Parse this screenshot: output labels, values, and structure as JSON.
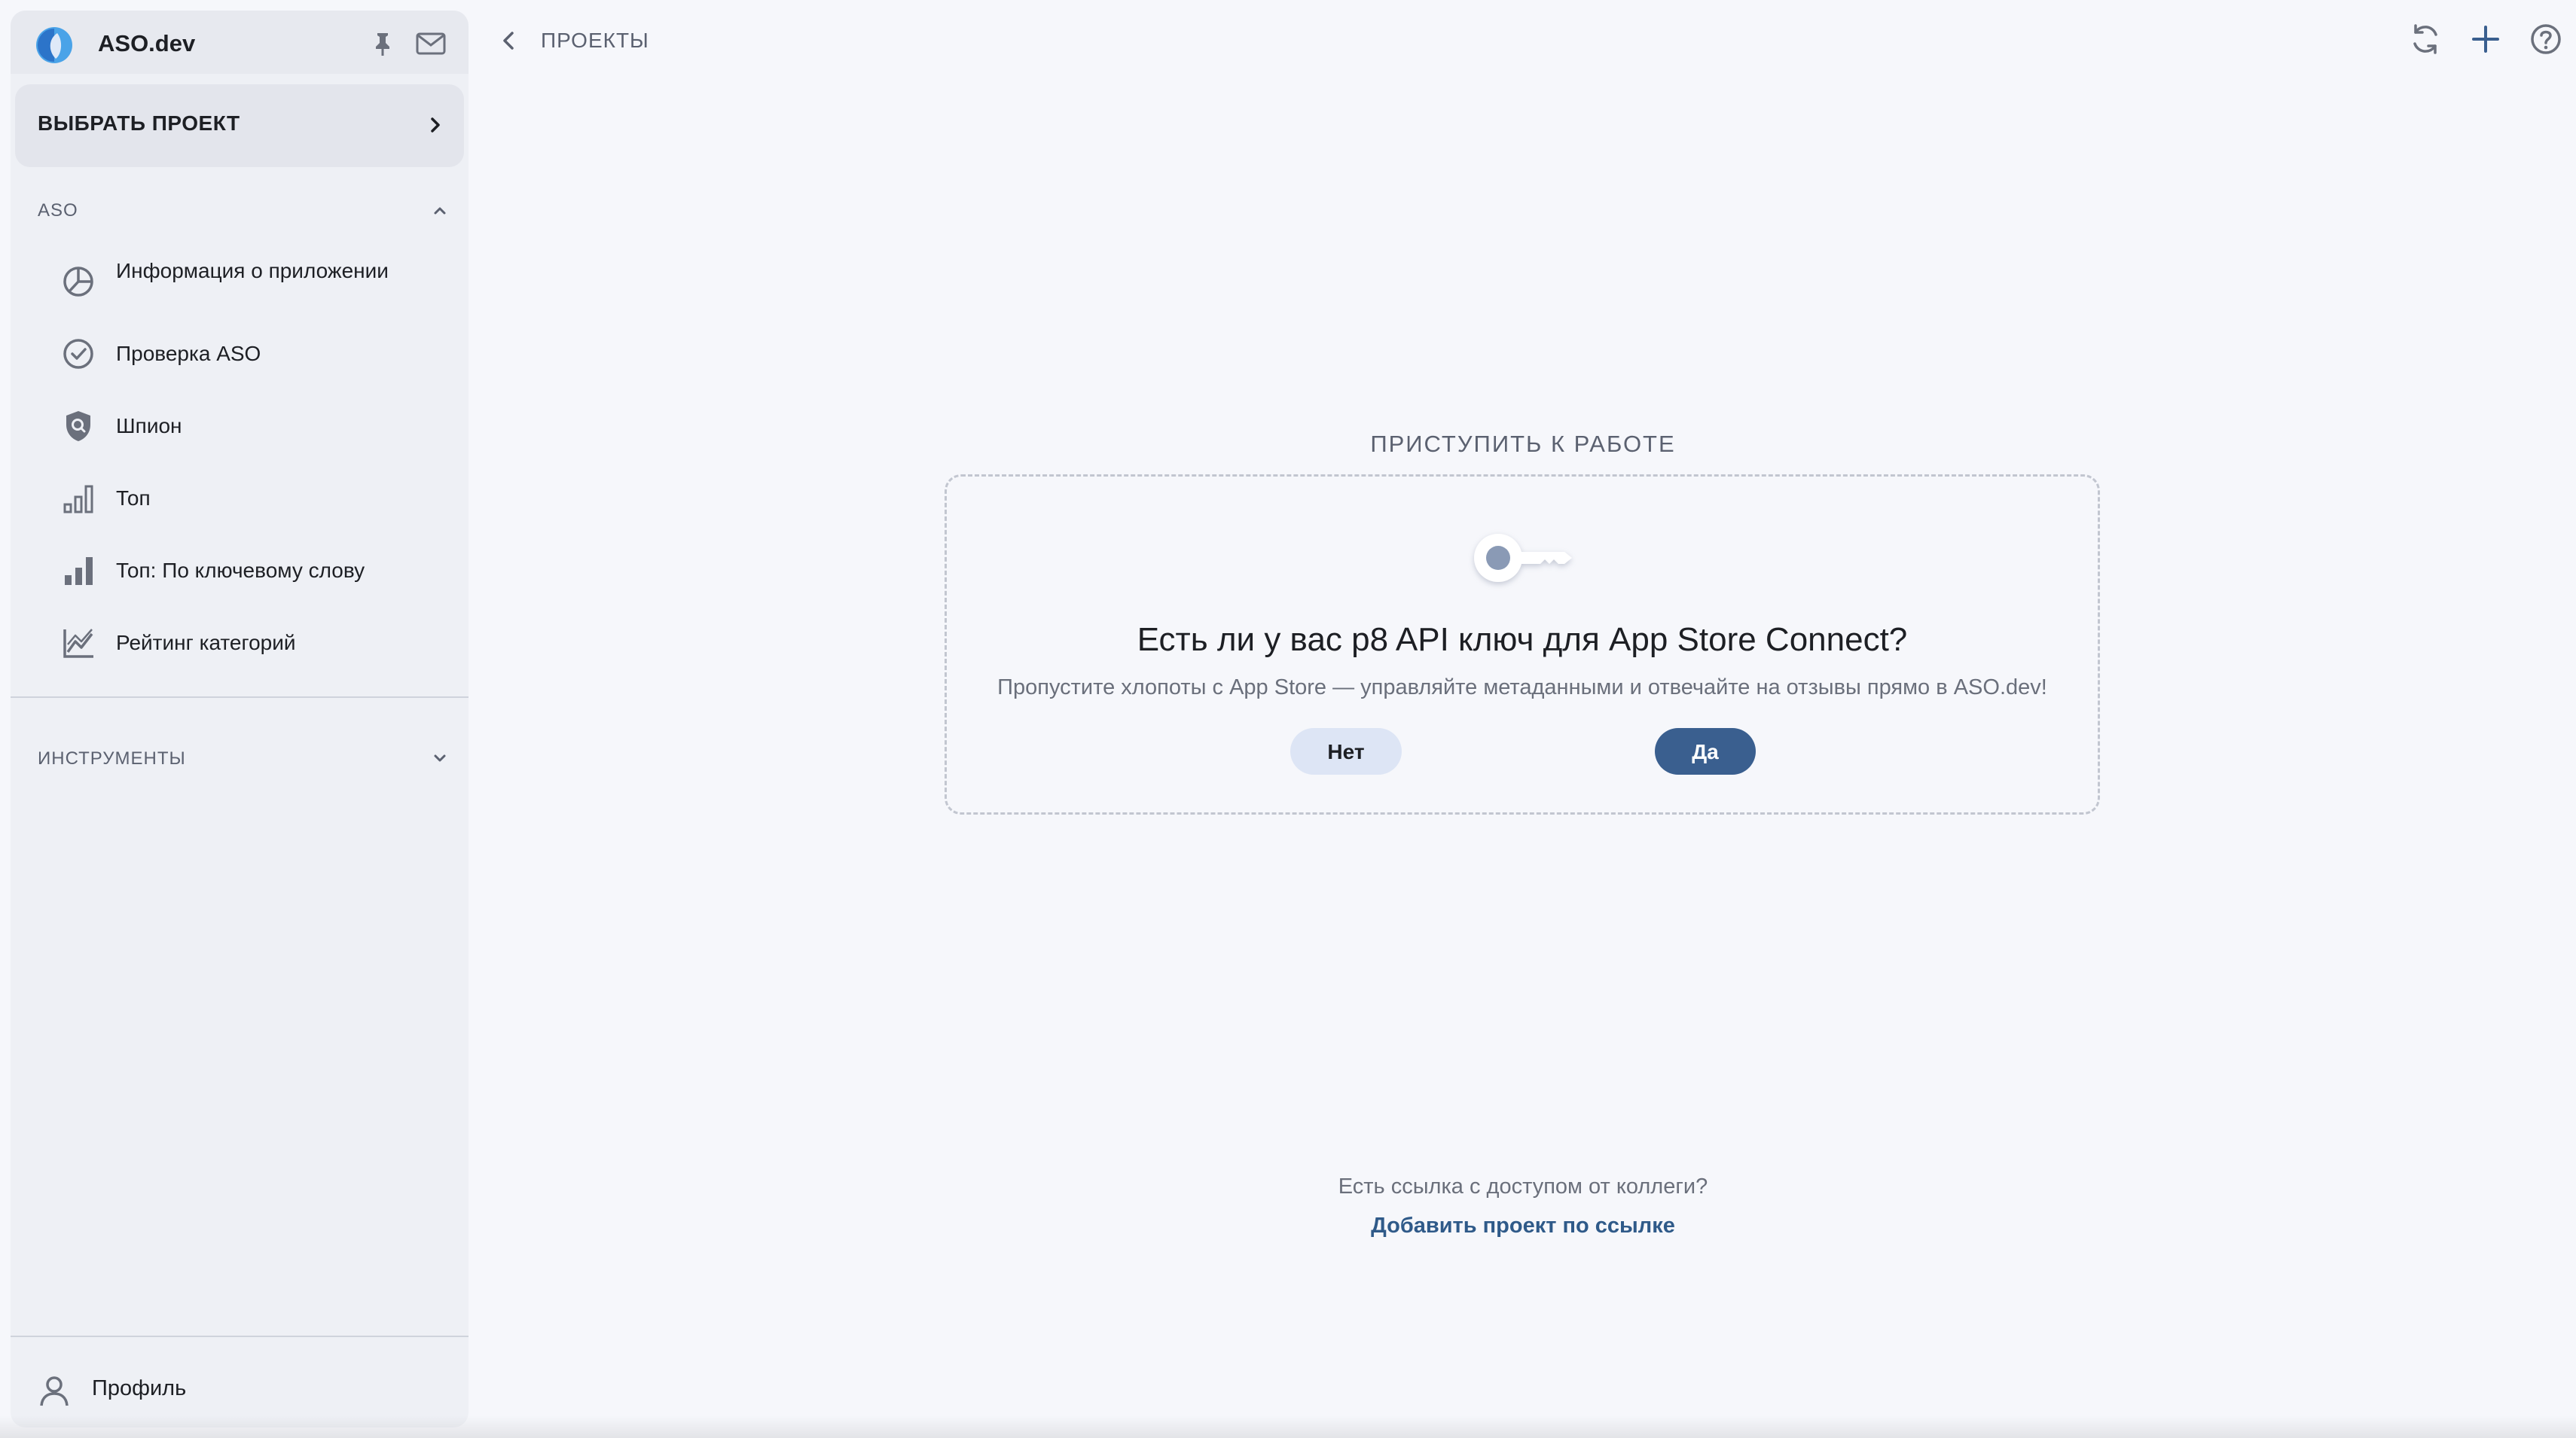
{
  "app": {
    "title": "ASO.dev"
  },
  "sidebar": {
    "project_select_label": "ВЫБРАТЬ ПРОЕКТ",
    "sections": [
      {
        "title": "ASO",
        "expanded": true,
        "items": [
          {
            "label": "Информация о приложении",
            "icon": "chart-pie-icon"
          },
          {
            "label": "Проверка ASO",
            "icon": "check-circle-icon"
          },
          {
            "label": "Шпион",
            "icon": "shield-search-icon"
          },
          {
            "label": "Топ",
            "icon": "bar-chart-outline-icon"
          },
          {
            "label": "Топ: По ключевому слову",
            "icon": "bar-chart-icon"
          },
          {
            "label": "Рейтинг категорий",
            "icon": "line-chart-icon"
          }
        ]
      },
      {
        "title": "ИНСТРУМЕНТЫ",
        "expanded": false,
        "items": []
      }
    ],
    "profile_label": "Профиль"
  },
  "topbar": {
    "breadcrumb": "ПРОЕКТЫ",
    "actions": [
      "refresh-icon",
      "plus-icon",
      "help-icon"
    ]
  },
  "main": {
    "heading": "ПРИСТУПИТЬ К РАБОТЕ",
    "card": {
      "icon": "key-icon",
      "title": "Есть ли у вас p8 API ключ для App Store Connect?",
      "subtitle": "Пропустите хлопоты с App Store — управляйте метаданными и отвечайте на отзывы прямо в ASO.dev!",
      "no_label": "Нет",
      "yes_label": "Да"
    },
    "footer_question": "Есть ссылка с доступом от коллеги?",
    "footer_link": "Добавить проект по ссылке"
  },
  "colors": {
    "background": "#f6f7fb",
    "sidebar": "#eef0f5",
    "accent": "#3a5f8f",
    "link": "#2f5a89",
    "secondary_button": "#dde5f5"
  }
}
